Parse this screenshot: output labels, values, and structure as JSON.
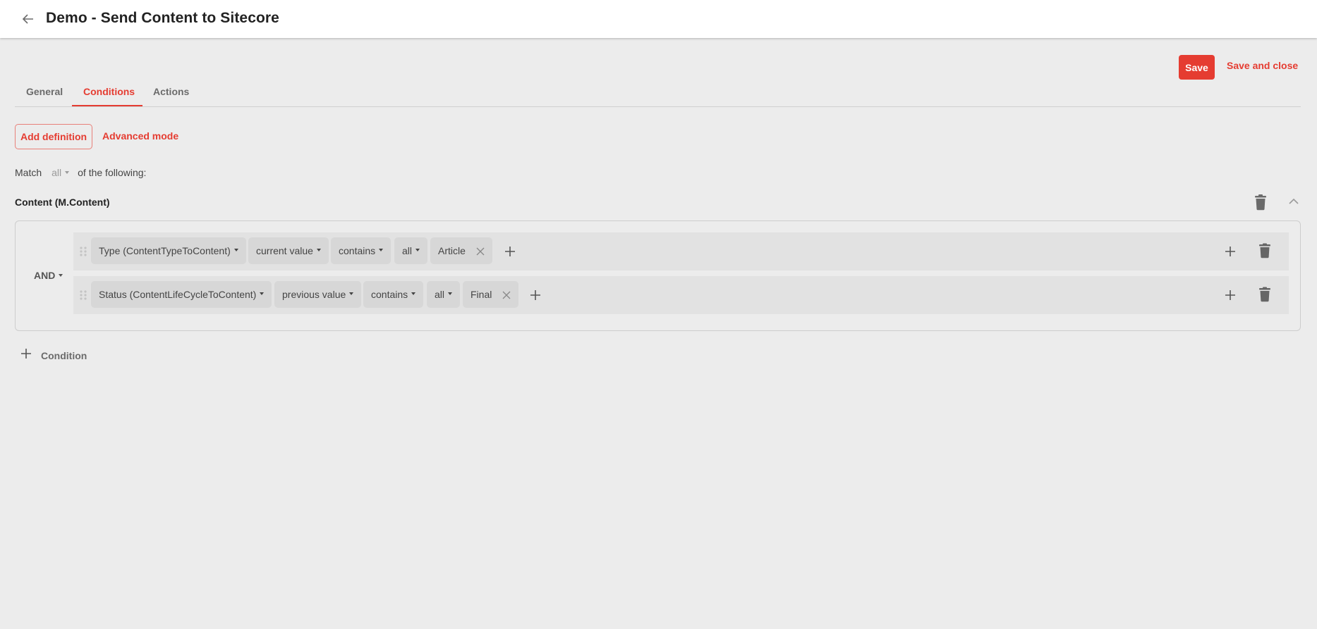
{
  "header": {
    "title": "Demo - Send Content to Sitecore",
    "back_icon": "arrow-left-icon"
  },
  "toolbar": {
    "save_label": "Save",
    "save_close_label": "Save and close"
  },
  "tabs": [
    {
      "label": "General",
      "active": false
    },
    {
      "label": "Conditions",
      "active": true
    },
    {
      "label": "Actions",
      "active": false
    }
  ],
  "definition": {
    "add_definition_label": "Add definition",
    "advanced_mode_label": "Advanced mode"
  },
  "match": {
    "prefix": "Match",
    "value": "all",
    "suffix": "of the following:"
  },
  "section": {
    "title": "Content (M.Content)",
    "operator": "AND",
    "conditions": [
      {
        "field": "Type (ContentTypeToContent)",
        "value_mode": "current value",
        "comparator": "contains",
        "quantifier": "all",
        "values": [
          "Article"
        ]
      },
      {
        "field": "Status (ContentLifeCycleToContent)",
        "value_mode": "previous value",
        "comparator": "contains",
        "quantifier": "all",
        "values": [
          "Final"
        ]
      }
    ],
    "add_condition_label": "Condition"
  },
  "colors": {
    "accent": "#e53c31",
    "background": "#ececec",
    "chip": "#d7d7d7",
    "row": "#e2e2e2"
  }
}
